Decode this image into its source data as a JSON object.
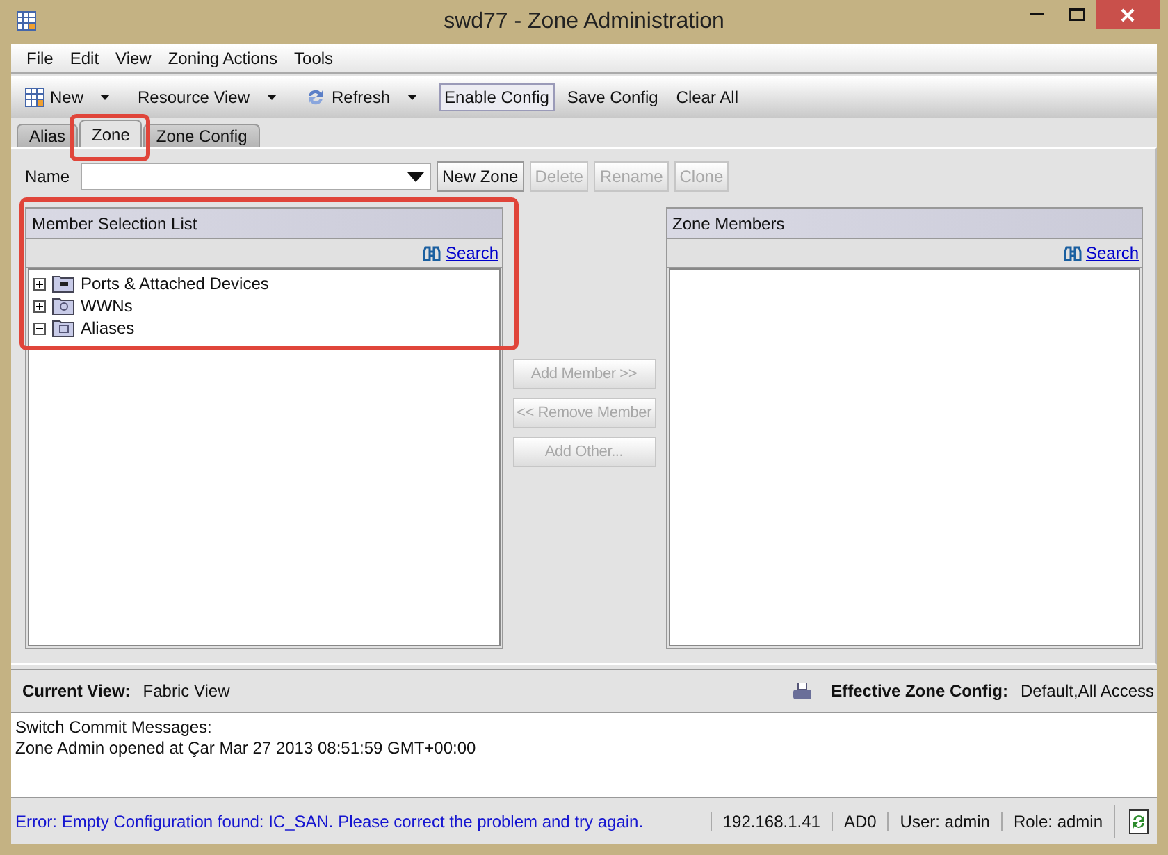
{
  "window": {
    "title": "swd77 - Zone Administration"
  },
  "menu": [
    "File",
    "Edit",
    "View",
    "Zoning Actions",
    "Tools"
  ],
  "toolbar": [
    {
      "kind": "dropdown",
      "label": "New"
    },
    {
      "kind": "dropdown",
      "label": "Resource View"
    },
    {
      "kind": "dropdown",
      "label": "Refresh"
    },
    {
      "kind": "button",
      "label": "Enable Config",
      "focused": true
    },
    {
      "kind": "button",
      "label": "Save Config",
      "focused": false
    },
    {
      "kind": "button",
      "label": "Clear All",
      "focused": false
    }
  ],
  "tabs": [
    {
      "label": "Alias",
      "selected": false
    },
    {
      "label": "Zone",
      "selected": true
    },
    {
      "label": "Zone Config",
      "selected": false
    }
  ],
  "name_row": {
    "label": "Name",
    "buttons": [
      {
        "label": "New Zone",
        "disabled": false
      },
      {
        "label": "Delete",
        "disabled": true
      },
      {
        "label": "Rename",
        "disabled": true
      },
      {
        "label": "Clone",
        "disabled": true
      }
    ]
  },
  "member_selection": {
    "title": "Member Selection List",
    "search": "Search",
    "tree": [
      {
        "label": "Ports & Attached Devices",
        "expanded": false
      },
      {
        "label": "WWNs",
        "expanded": false
      },
      {
        "label": "Aliases",
        "expanded": true
      }
    ]
  },
  "actions": [
    {
      "label": "Add Member >>",
      "disabled": true
    },
    {
      "label": "<< Remove Member",
      "disabled": true
    },
    {
      "label": "Add Other...",
      "disabled": true
    }
  ],
  "zone_members": {
    "title": "Zone Members",
    "search": "Search"
  },
  "view_bar": {
    "current_label": "Current View:",
    "current_value": "Fabric View",
    "effective_label": "Effective Zone Config:",
    "effective_value": "Default,All Access"
  },
  "messages": [
    "Switch Commit Messages:",
    "Zone Admin opened at Çar Mar 27 2013 08:51:59 GMT+00:00"
  ],
  "status_bar": {
    "error": "Error: Empty Configuration found: IC_SAN. Please correct the problem and try again.",
    "fields": [
      "192.168.1.41",
      "AD0",
      "User: admin",
      "Role: admin"
    ]
  }
}
